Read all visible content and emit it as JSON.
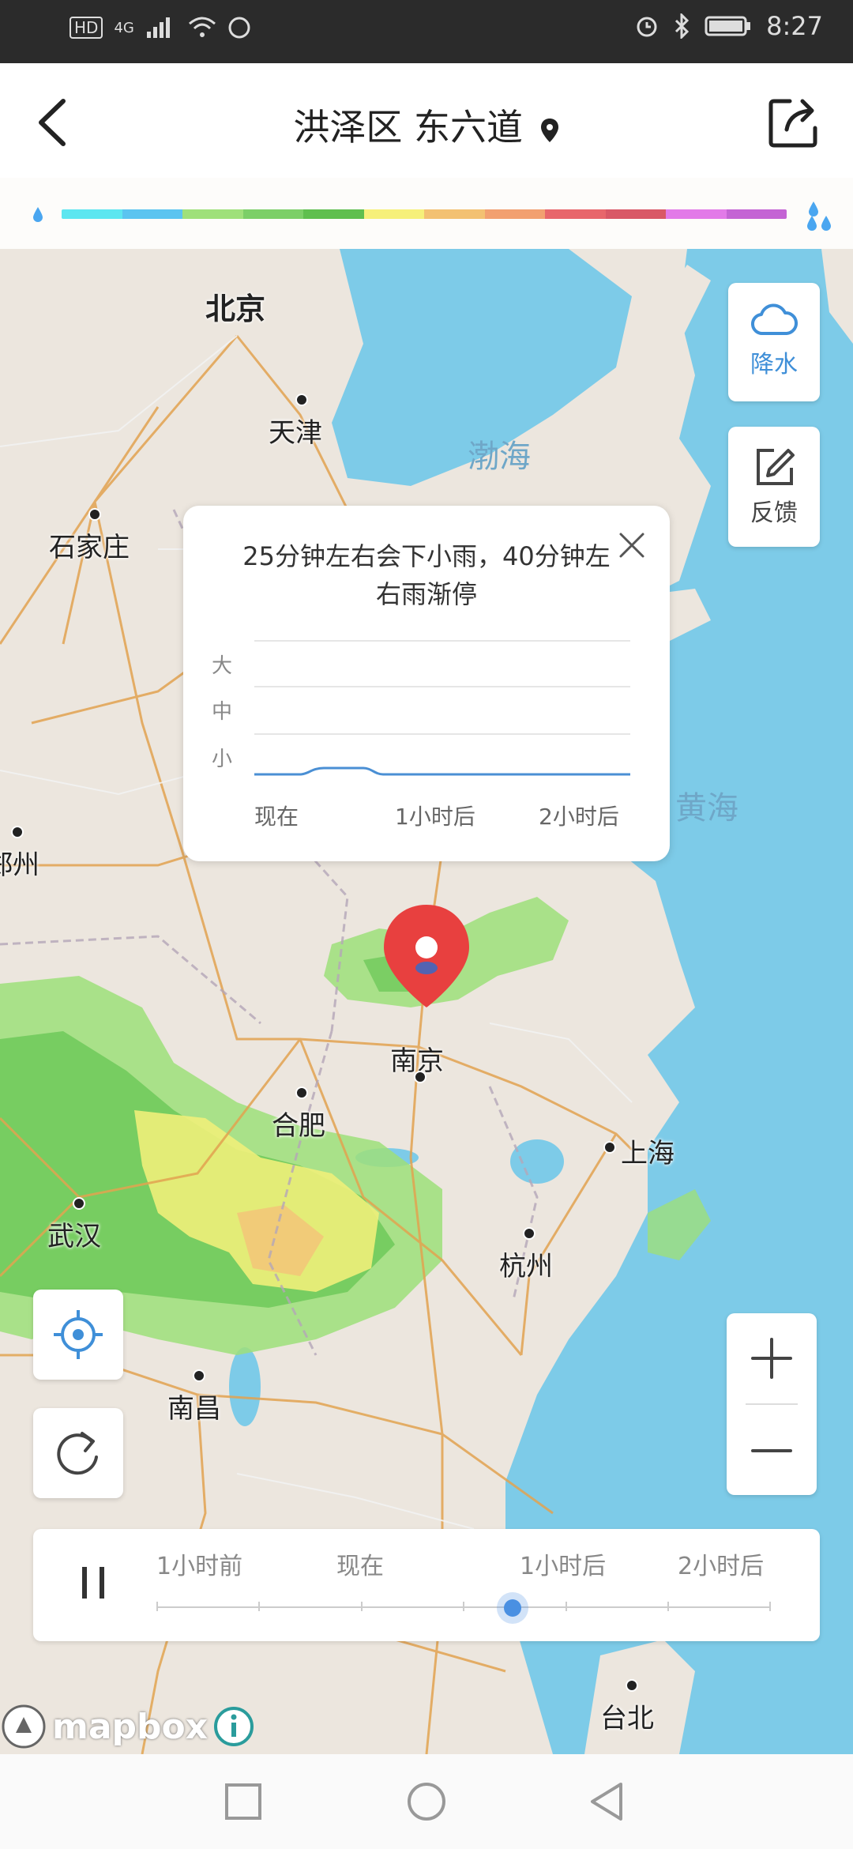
{
  "status_bar": {
    "hd": "HD",
    "network": "4G",
    "time": "8:27"
  },
  "header": {
    "title": "洪泽区 东六道"
  },
  "legend": {
    "colors": [
      "#5de6f0",
      "#5bc4f0",
      "#9fe07a",
      "#7ccf68",
      "#5fbf4f",
      "#f6f07a",
      "#f3c172",
      "#f2a070",
      "#e8666b",
      "#d95866",
      "#e27ae8",
      "#c464d4"
    ]
  },
  "map": {
    "cities": [
      {
        "name": "北京"
      },
      {
        "name": "天津"
      },
      {
        "name": "石家庄"
      },
      {
        "name": "郑州"
      },
      {
        "name": "南京"
      },
      {
        "name": "合肥"
      },
      {
        "name": "上海"
      },
      {
        "name": "武汉"
      },
      {
        "name": "杭州"
      },
      {
        "name": "南昌"
      },
      {
        "name": "台北"
      }
    ],
    "seas": [
      {
        "name": "渤海"
      },
      {
        "name": "黄海"
      }
    ]
  },
  "side_buttons": {
    "precipitation": {
      "label": "降水",
      "icon": "cloud-icon"
    },
    "feedback": {
      "label": "反馈",
      "icon": "edit-icon"
    }
  },
  "popup": {
    "message": "25分钟左右会下小雨，40分钟左右雨渐停",
    "y_labels": [
      "大",
      "中",
      "小"
    ],
    "x_labels": [
      "现在",
      "1小时后",
      "2小时后"
    ]
  },
  "timeline": {
    "labels": [
      "1小时前",
      "现在",
      "1小时后",
      "2小时后"
    ],
    "progress": 0.58
  },
  "attribution": {
    "brand": "mapbox"
  }
}
